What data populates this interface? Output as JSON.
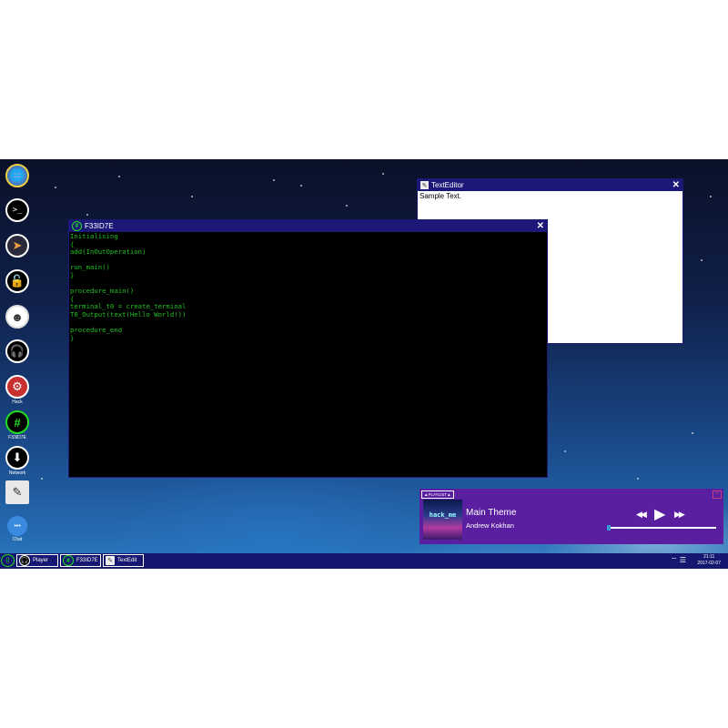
{
  "desktop_icons": [
    {
      "name": "browser",
      "glyph": "🌐",
      "caption": ""
    },
    {
      "name": "terminal",
      "glyph": ">_",
      "caption": ""
    },
    {
      "name": "mail",
      "glyph": "➤",
      "caption": ""
    },
    {
      "name": "unlock",
      "glyph": "🔓",
      "caption": ""
    },
    {
      "name": "ghost",
      "glyph": "☻",
      "caption": ""
    },
    {
      "name": "player",
      "glyph": "🎧",
      "caption": ""
    },
    {
      "name": "hexeditor",
      "glyph": "⚙",
      "caption": "Hack"
    },
    {
      "name": "f33id7e",
      "glyph": "#",
      "caption": "F33ID7E"
    },
    {
      "name": "download",
      "glyph": "⬇",
      "caption": "Network"
    },
    {
      "name": "textedit",
      "glyph": "✎",
      "caption": ""
    },
    {
      "name": "chat",
      "glyph": "•••",
      "caption": "Chat"
    }
  ],
  "texteditor": {
    "title": "TextEditor",
    "content": "Sample Text.",
    "close": "✕"
  },
  "terminal": {
    "title": "F33ID7E",
    "close": "✕",
    "code": "Initialising\n{\nadd(InOutOperation)\n\nrun_main()\n}\n\nprocedure_main()\n{\nterminal_t0 = create_terminal\nT0_Output(text(Hello World!))\n\nprocedure_end\n}"
  },
  "player": {
    "playlist_tab": "▲PLAYLIST▲",
    "close": "×",
    "cover_text": "hack_me",
    "song": "Main Theme",
    "artist": "Andrew Kokhan",
    "rewind": "◀◀",
    "play": "▶",
    "forward": "▶▶",
    "progress": 0.0
  },
  "taskbar": {
    "start_glyph": "{}",
    "buttons": [
      {
        "label": "Player",
        "glyph": "🎧"
      },
      {
        "label": "F33ID7E",
        "glyph": "#"
      },
      {
        "label": "TextEdit",
        "glyph": "✎"
      }
    ],
    "tray": "⌔ ☰",
    "time": "21:11",
    "date": "2017-02-07"
  },
  "colors": {
    "titlebar": "#1c1878",
    "terminal_text": "#20c020",
    "player_bg": "#5a1ea0",
    "taskbar": "#141870"
  }
}
